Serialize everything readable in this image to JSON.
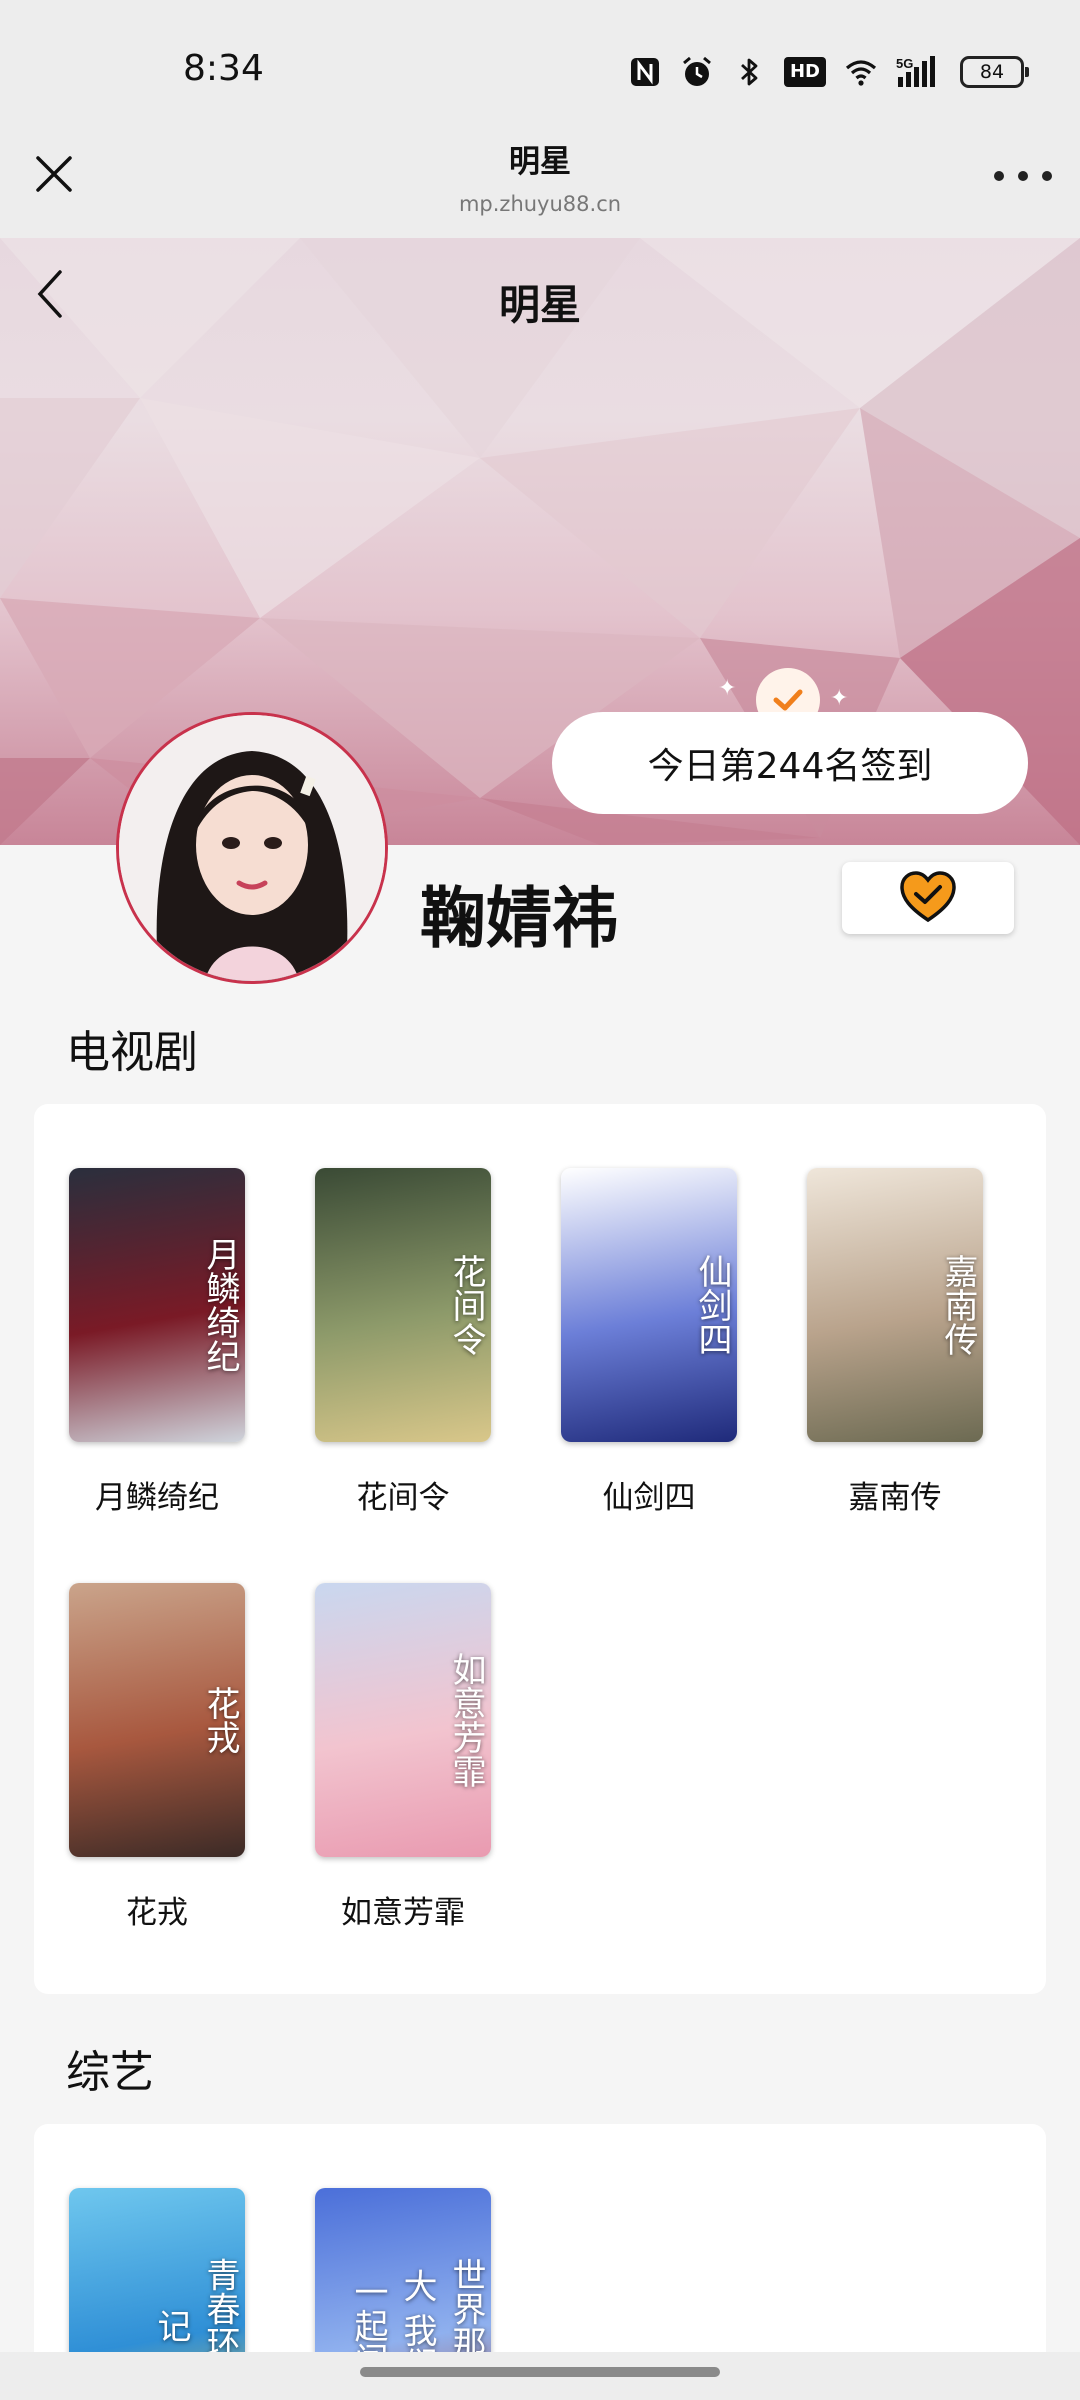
{
  "status_bar": {
    "time": "8:34",
    "battery": "84",
    "hd_label": "HD",
    "network_label": "5G",
    "icons": [
      "nfc-icon",
      "alarm-icon",
      "bluetooth-icon",
      "hd-icon",
      "wifi-icon",
      "signal-icon",
      "battery-icon"
    ]
  },
  "mini_program": {
    "title": "明星",
    "url": "mp.zhuyu88.cn"
  },
  "header": {
    "title": "明星",
    "checkin_text": "今日第244名签到"
  },
  "profile": {
    "name": "鞠婧祎"
  },
  "sections": {
    "tv": {
      "title": "电视剧",
      "items": [
        {
          "label": "月鳞绮纪",
          "poster_text": "月鳞绮纪",
          "colors": [
            "#2a2f3d",
            "#7a1a26",
            "#cfd4dc"
          ]
        },
        {
          "label": "花间令",
          "poster_text": "花间令",
          "colors": [
            "#3a4a35",
            "#8d9a6a",
            "#d9c78a"
          ]
        },
        {
          "label": "仙剑四",
          "poster_text": "仙剑四",
          "colors": [
            "#ffffff",
            "#6c7fd8",
            "#1f2a7a"
          ]
        },
        {
          "label": "嘉南传",
          "poster_text": "嘉南传",
          "colors": [
            "#efe6da",
            "#b9a38c",
            "#6c6a52"
          ]
        },
        {
          "label": "花戎",
          "poster_text": "花戎",
          "colors": [
            "#caa48b",
            "#a8583f",
            "#3b2a26"
          ]
        },
        {
          "label": "如意芳霏",
          "poster_text": "如意芳霏",
          "colors": [
            "#c9d7ef",
            "#f2c4cf",
            "#e99ab0"
          ]
        }
      ]
    },
    "variety": {
      "title": "综艺",
      "items": [
        {
          "label": "",
          "poster_text": "青春环游记",
          "colors": [
            "#6fc7ee",
            "#2f8fd6",
            "#f6c53b"
          ]
        },
        {
          "label": "",
          "poster_text": "世界那么大 我们一起闯",
          "colors": [
            "#4b6fd9",
            "#8fb0ee",
            "#b4482e"
          ]
        }
      ]
    }
  },
  "accent_colors": {
    "avatar_border": "#c8324c",
    "follow_heart": "#f59a1b",
    "check_mark": "#f07f1c"
  }
}
